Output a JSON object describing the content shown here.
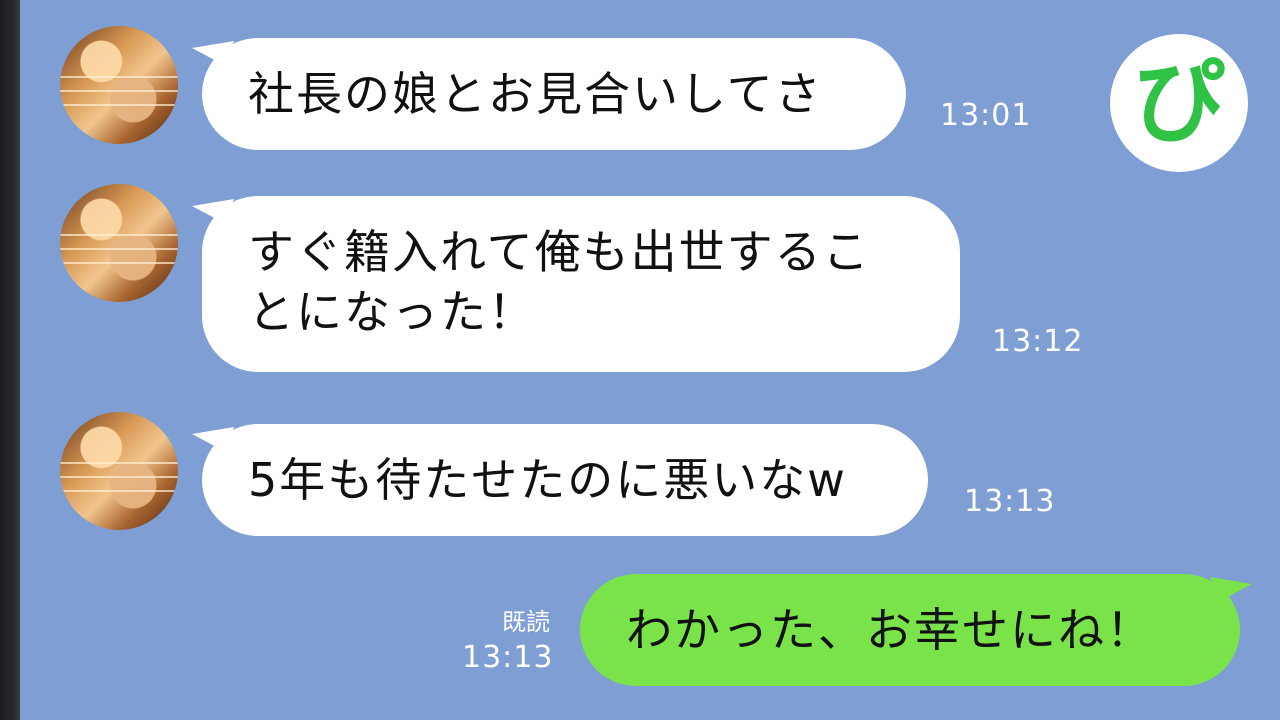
{
  "chat": {
    "messages": [
      {
        "direction": "incoming",
        "text": "社長の娘とお見合いしてさ",
        "time": "13:01"
      },
      {
        "direction": "incoming",
        "lines": [
          "すぐ籍入れて俺も出世するこ",
          "とになった！"
        ],
        "time": "13:12"
      },
      {
        "direction": "incoming",
        "text": "5年も待たせたのに悪いなw",
        "time": "13:13"
      },
      {
        "direction": "outgoing",
        "text": "わかった、お幸せにね！",
        "time": "13:13",
        "read_label": "既読"
      }
    ]
  },
  "logo": {
    "glyph": "ぴ",
    "color": "#2fc244"
  },
  "colors": {
    "background": "#7f9fd4",
    "incoming_bubble": "#ffffff",
    "outgoing_bubble": "#7ae34a",
    "timestamp": "#ffffff"
  }
}
